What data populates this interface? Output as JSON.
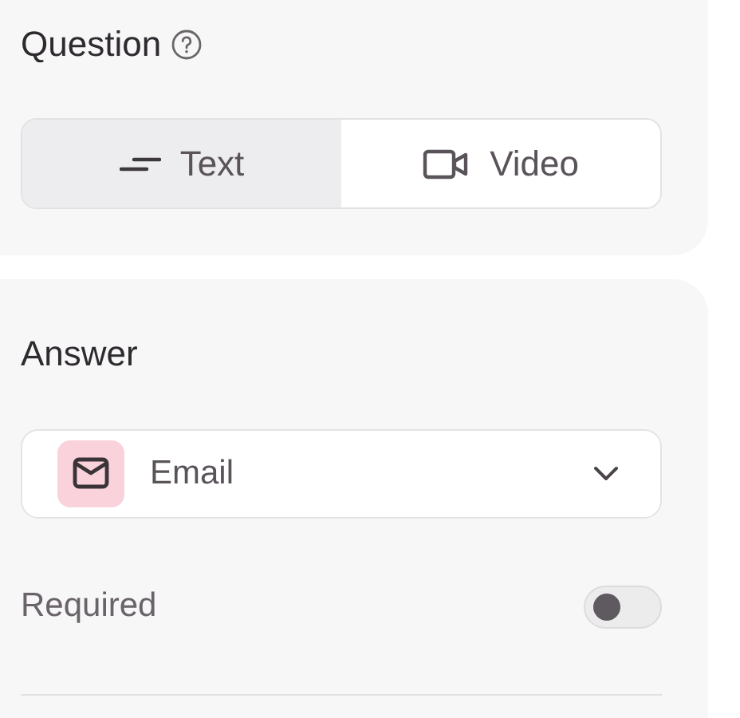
{
  "question": {
    "title": "Question",
    "format_options": [
      {
        "label": "Text",
        "kind": "text",
        "selected": true
      },
      {
        "label": "Video",
        "kind": "video",
        "selected": false
      }
    ]
  },
  "answer": {
    "title": "Answer",
    "type": {
      "label": "Email",
      "kind": "email"
    },
    "required": {
      "label": "Required",
      "on": false
    }
  }
}
